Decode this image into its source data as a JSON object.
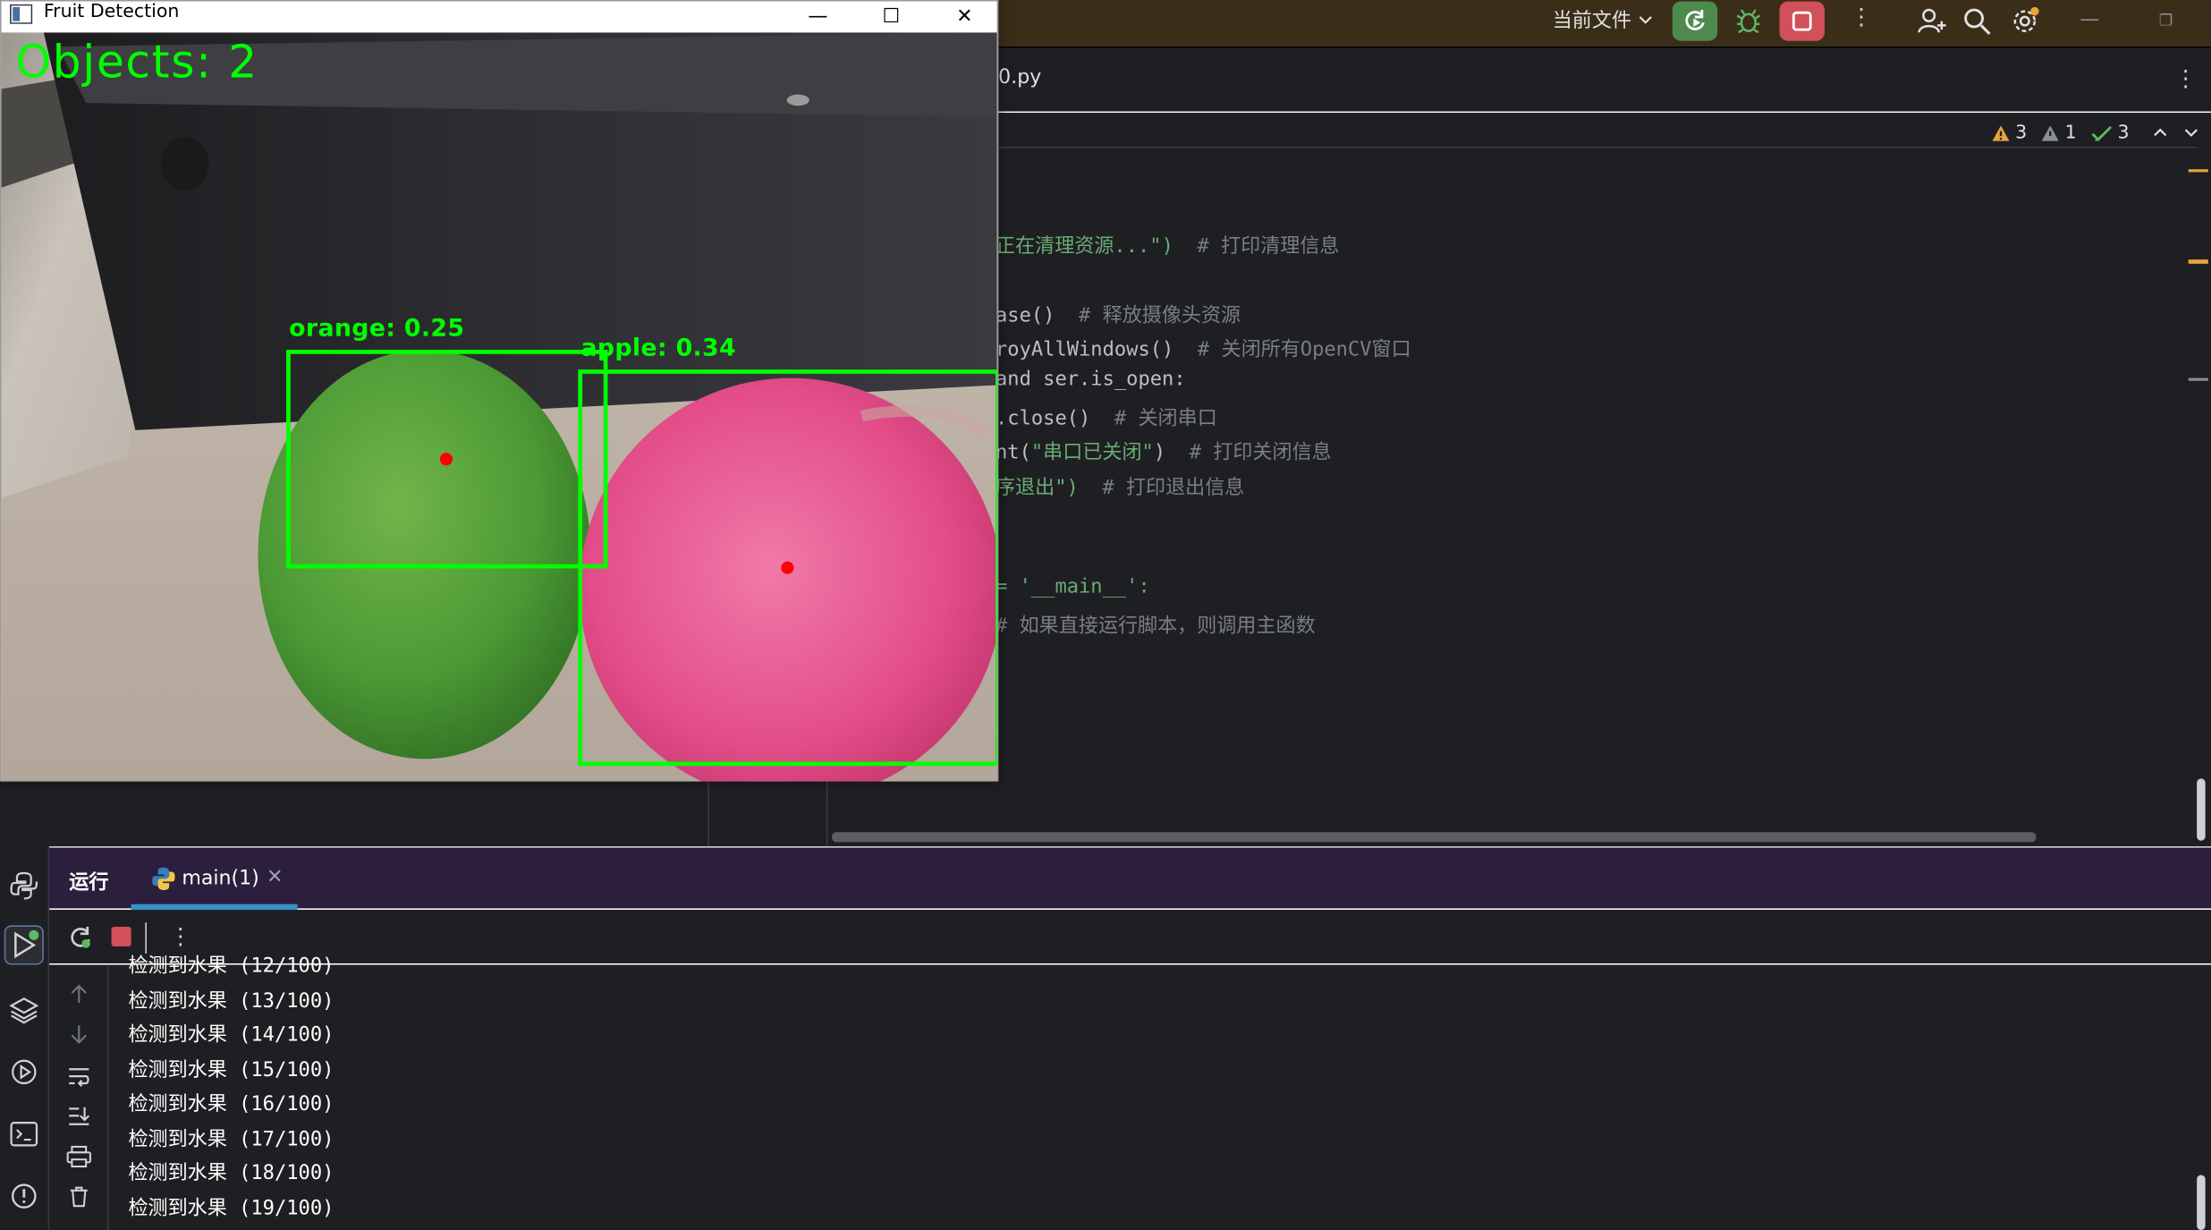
{
  "ide": {
    "run_config": "当前文件",
    "editor_tab_name": "0.py",
    "inspections": {
      "warnings": "3",
      "weak_warnings": "1",
      "ok": "3"
    },
    "code_lines": [
      {
        "code": "正在清理资源...\")  ",
        "comment": "# 打印清理信息",
        "kind": "str"
      },
      {
        "code": "ase()  ",
        "comment": "# 释放摄像头资源",
        "kind": "plain"
      },
      {
        "code": "royAllWindows()  ",
        "comment": "# 关闭所有OpenCV窗口",
        "kind": "plain"
      },
      {
        "code": "and ser.is_open:",
        "comment": "",
        "kind": "plain"
      },
      {
        "code": ".close()  ",
        "comment": "# 关闭串口",
        "kind": "plain"
      },
      {
        "code": "nt(\"串口已关闭\")  ",
        "comment": "# 打印关闭信息",
        "kind": "mixed"
      },
      {
        "code": "序退出\")  ",
        "comment": "# 打印退出信息",
        "kind": "str"
      },
      {
        "code": "= '__main__':",
        "comment": "",
        "kind": "main"
      },
      {
        "code": "",
        "comment": "# 如果直接运行脚本，则调用主函数",
        "kind": "plain"
      }
    ]
  },
  "run_panel": {
    "title": "运行",
    "tab_label": "main(1)",
    "console_lines": [
      "检测到水果 (12/100)",
      "检测到水果 (13/100)",
      "检测到水果 (14/100)",
      "检测到水果 (15/100)",
      "检测到水果 (16/100)",
      "检测到水果 (17/100)",
      "检测到水果 (18/100)",
      "检测到水果 (19/100)"
    ]
  },
  "cv_window": {
    "title": "Fruit Detection",
    "objects_text": "Objects: 2",
    "detections": [
      {
        "label": "orange: 0.25"
      },
      {
        "label": "apple: 0.34"
      }
    ]
  },
  "colors": {
    "detection": "#00ff00",
    "center_dot": "#ff0000",
    "run_button": "#4e8a4e",
    "stop_button": "#d1505a",
    "accent": "#3592c4"
  }
}
